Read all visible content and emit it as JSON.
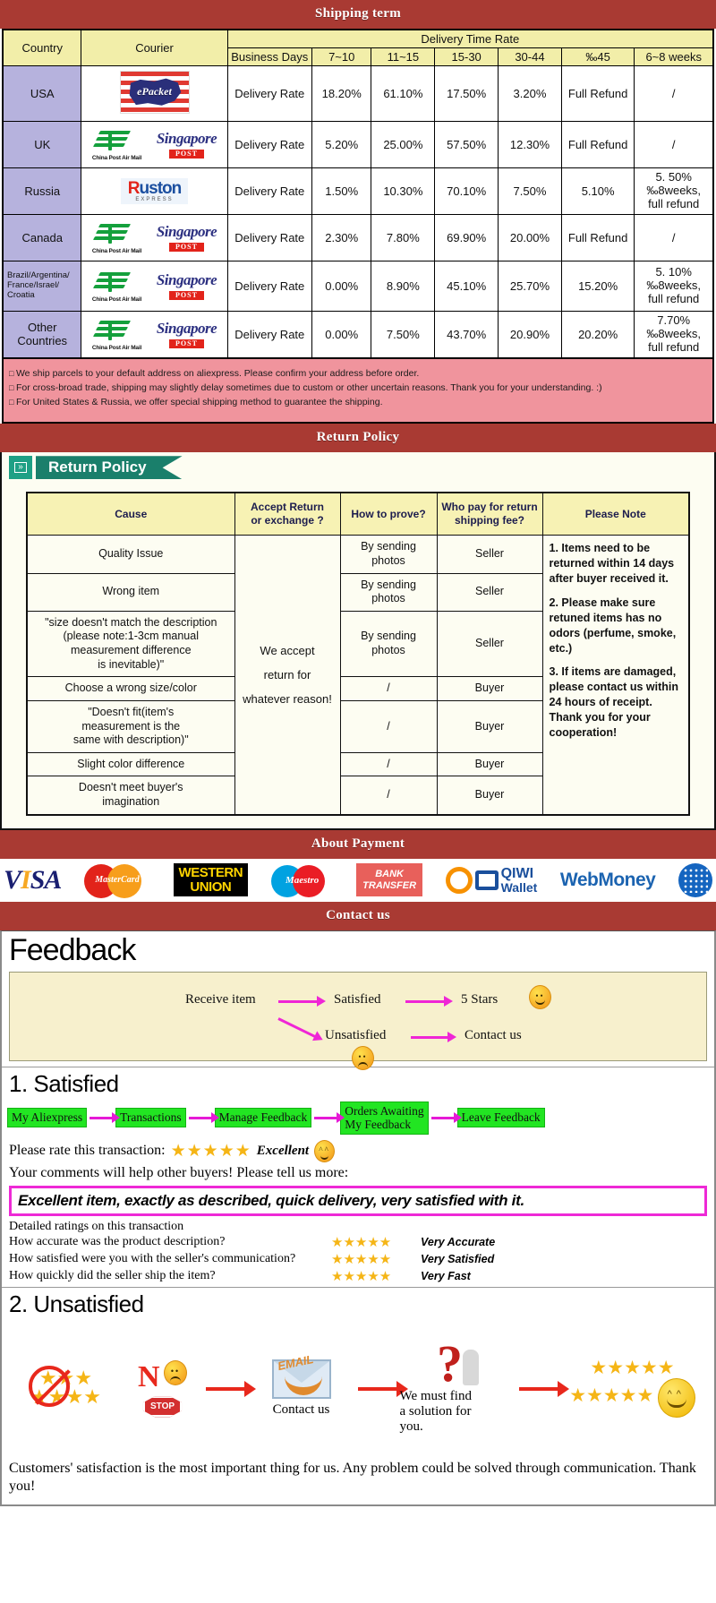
{
  "banners": {
    "shipping": "Shipping term",
    "return": "Return Policy",
    "payment": "About Payment",
    "contact": "Contact us"
  },
  "shipping": {
    "headers": {
      "country": "Country",
      "courier": "Courier",
      "delivery_time_rate": "Delivery Time Rate",
      "business_days": "Business Days",
      "ranges": [
        "7~10",
        "11~15",
        "15-30",
        "30-44",
        "‰45",
        "6~8 weeks"
      ]
    },
    "rate_label": "Delivery Rate",
    "rows": [
      {
        "country": "USA",
        "couriers": [
          "epacket"
        ],
        "values": [
          "18.20%",
          "61.10%",
          "17.50%",
          "3.20%",
          "Full Refund",
          "/"
        ]
      },
      {
        "country": "UK",
        "couriers": [
          "china-post-air-mail",
          "singapore-post"
        ],
        "values": [
          "5.20%",
          "25.00%",
          "57.50%",
          "12.30%",
          "Full Refund",
          "/"
        ]
      },
      {
        "country": "Russia",
        "couriers": [
          "ruston-express"
        ],
        "values": [
          "1.50%",
          "10.30%",
          "70.10%",
          "7.50%",
          "5.10%",
          "5. 50%\n‰8weeks,\nfull refund"
        ]
      },
      {
        "country": "Canada",
        "couriers": [
          "china-post-air-mail",
          "singapore-post"
        ],
        "values": [
          "2.30%",
          "7.80%",
          "69.90%",
          "20.00%",
          "Full Refund",
          "/"
        ]
      },
      {
        "country": "Brazil/Argentina/ France/Israel/ Croatia",
        "couriers": [
          "china-post-air-mail",
          "singapore-post"
        ],
        "values": [
          "0.00%",
          "8.90%",
          "45.10%",
          "25.70%",
          "15.20%",
          "5. 10%\n‰8weeks,\nfull refund"
        ]
      },
      {
        "country": "Other Countries",
        "couriers": [
          "china-post-air-mail",
          "singapore-post"
        ],
        "values": [
          "0.00%",
          "7.50%",
          "43.70%",
          "20.90%",
          "20.20%",
          "7.70%\n‰8weeks,\nfull refund"
        ]
      }
    ],
    "notes": [
      "We ship parcels to your default address on aliexpress. Please confirm your address before order.",
      "For cross-broad trade, shipping may slightly delay sometimes due to custom or other uncertain reasons. Thank you for your understanding. :)",
      "For United States & Russia, we offer special shipping method to guarantee the shipping."
    ],
    "courier_labels": {
      "epacket": "ePacket",
      "china_post": "China Post Air Mail",
      "singapore_word": "Singapore",
      "singapore_post": "POST",
      "ruston": "Ruston",
      "ruston_sub": "EXPRESS"
    }
  },
  "return_policy": {
    "ribbon_label": "Return Policy",
    "headers": [
      "Cause",
      "Accept Return\nor exchange ?",
      "How to prove?",
      "Who pay for return\nshipping fee?",
      "Please Note"
    ],
    "accept_text": "We accept\nreturn for\nwhatever reason!",
    "rows": [
      {
        "cause": "Quality Issue",
        "prove": "By sending\nphotos",
        "payer": "Seller"
      },
      {
        "cause": "Wrong item",
        "prove": "By sending\nphotos",
        "payer": "Seller"
      },
      {
        "cause": "\"size doesn't match the description\n(please note:1-3cm manual\nmeasurement difference\nis inevitable)\"",
        "prove": "By sending\nphotos",
        "payer": "Seller"
      },
      {
        "cause": "Choose a wrong size/color",
        "prove": "/",
        "payer": "Buyer"
      },
      {
        "cause": "\"Doesn't fit(item's\nmeasurement is the\nsame with description)\"",
        "prove": "/",
        "payer": "Buyer"
      },
      {
        "cause": "Slight color difference",
        "prove": "/",
        "payer": "Buyer"
      },
      {
        "cause": "Doesn't meet buyer's\nimagination",
        "prove": "/",
        "payer": "Buyer"
      }
    ],
    "notes": [
      "1. Items need to be returned within 14 days after buyer received it.",
      "2. Please make sure retuned items has no odors (perfume, smoke, etc.)",
      "3. If items are damaged, please contact us within 24 hours of receipt.",
      "Thank you for your cooperation!"
    ]
  },
  "payment": {
    "methods": [
      {
        "name": "visa",
        "label": "VISA"
      },
      {
        "name": "mastercard",
        "label": "MasterCard"
      },
      {
        "name": "western-union",
        "label_top": "WESTERN",
        "label_bottom": "UNION"
      },
      {
        "name": "maestro",
        "label": "Maestro"
      },
      {
        "name": "bank-transfer",
        "label_top": "BANK",
        "label_bottom": "TRANSFER"
      },
      {
        "name": "qiwi-wallet",
        "label_top": "QIWI",
        "label_bottom": "Wallet"
      },
      {
        "name": "webmoney",
        "label": "WebMoney"
      },
      {
        "name": "webmoney-globe",
        "label": ""
      }
    ]
  },
  "feedback": {
    "title": "Feedback",
    "flow": {
      "receive_item": "Receive item",
      "satisfied": "Satisfied",
      "five_stars": "5 Stars",
      "unsatisfied": "Unsatisfied",
      "contact_us": "Contact us"
    },
    "satisfied": {
      "heading": "1. Satisfied",
      "steps": [
        "My Aliexpress",
        "Transactions",
        "Manage Feedback",
        "Orders Awaiting\nMy Feedback",
        "Leave Feedback"
      ],
      "rate_prompt": "Please rate this transaction:",
      "stars": "★★★★★",
      "rate_word": "Excellent",
      "comments_prompt": "Your comments will help other buyers! Please tell us more:",
      "quote": "Excellent item, exactly as described, quick delivery, very satisfied with it.",
      "detailed_title": "Detailed ratings on this transaction",
      "detailed": [
        {
          "question": "How accurate was the product description?",
          "stars": "★★★★★",
          "label": "Very Accurate"
        },
        {
          "question": "How satisfied were you with the seller's communication?",
          "stars": "★★★★★",
          "label": "Very Satisfied"
        },
        {
          "question": "How quickly did the seller ship the item?",
          "stars": "★★★★★",
          "label": "Very Fast"
        }
      ]
    },
    "unsatisfied": {
      "heading": "2. Unsatisfied",
      "no_label": "N",
      "stop_label": "STOP",
      "email_label": "EMAIL",
      "contact_caption": "Contact us",
      "solution_caption": "We must find\na solution for\nyou.",
      "closing": "Customers' satisfaction is the most important thing for us. Any problem could be solved through communication. Thank you!"
    }
  },
  "colors": {
    "banner": "#a93a33",
    "header_yellow": "#f2eea9",
    "country_purple": "#b6b2dd",
    "note_pink": "#f0949d",
    "ribbon_teal": "#1a7f6b",
    "step_green": "#22e522",
    "magenta": "#ee29d6",
    "star_gold": "#f5b516"
  }
}
